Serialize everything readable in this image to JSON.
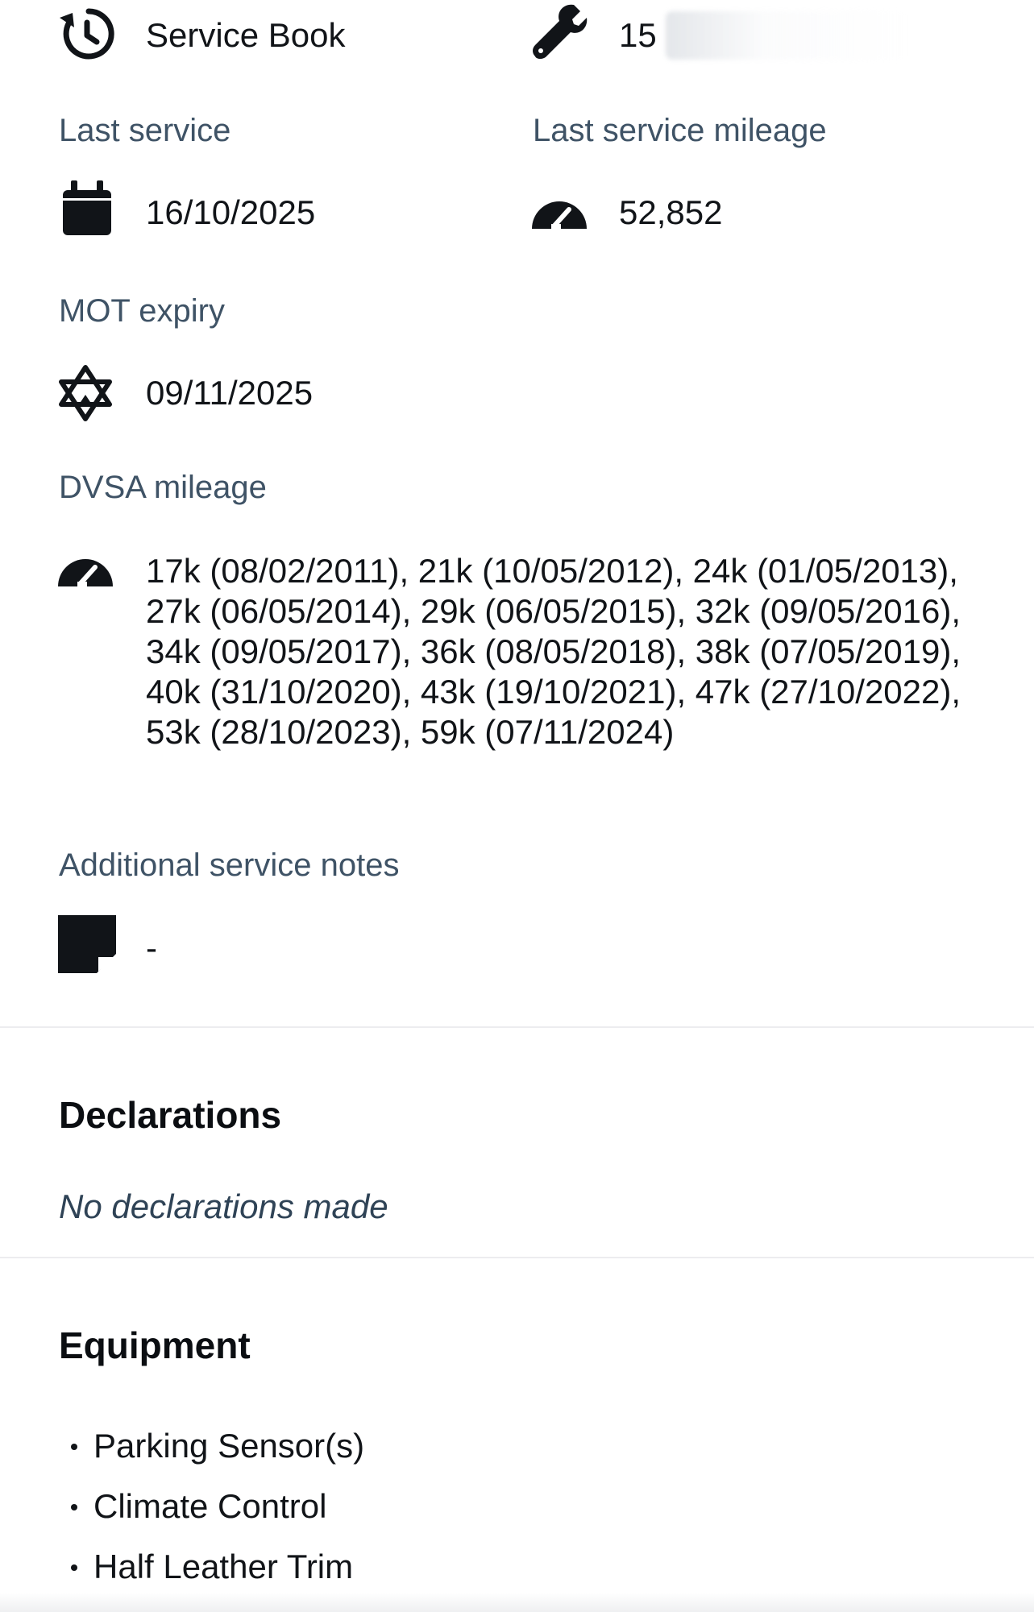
{
  "service_book": {
    "icon": "history-icon",
    "label": "Service Book",
    "services_icon": "wrench-icon",
    "services_value": "15"
  },
  "last_service": {
    "label": "Last service",
    "icon": "calendar-icon",
    "value": "16/10/2025"
  },
  "last_service_mileage": {
    "label": "Last service mileage",
    "icon": "speedometer-icon",
    "value": "52,852"
  },
  "mot_expiry": {
    "label": "MOT expiry",
    "icon": "mot-triangles-icon",
    "value": "09/11/2025"
  },
  "dvsa_mileage": {
    "label": "DVSA mileage",
    "icon": "speedometer-icon",
    "value": "17k (08/02/2011), 21k (10/05/2012), 24k (01/05/2013), 27k (06/05/2014), 29k (06/05/2015), 32k (09/05/2016), 34k (09/05/2017), 36k (08/05/2018), 38k (07/05/2019), 40k (31/10/2020), 43k (19/10/2021), 47k (27/10/2022), 53k (28/10/2023), 59k (07/11/2024)"
  },
  "additional_notes": {
    "label": "Additional service notes",
    "icon": "sticky-note-icon",
    "value": "-"
  },
  "declarations": {
    "title": "Declarations",
    "note": "No declarations made"
  },
  "equipment": {
    "title": "Equipment",
    "items": [
      "Parking Sensor(s)",
      "Climate Control",
      "Half Leather Trim"
    ]
  },
  "colors": {
    "text_primary": "#111418",
    "label": "#3f5366",
    "divider": "#ececef"
  }
}
